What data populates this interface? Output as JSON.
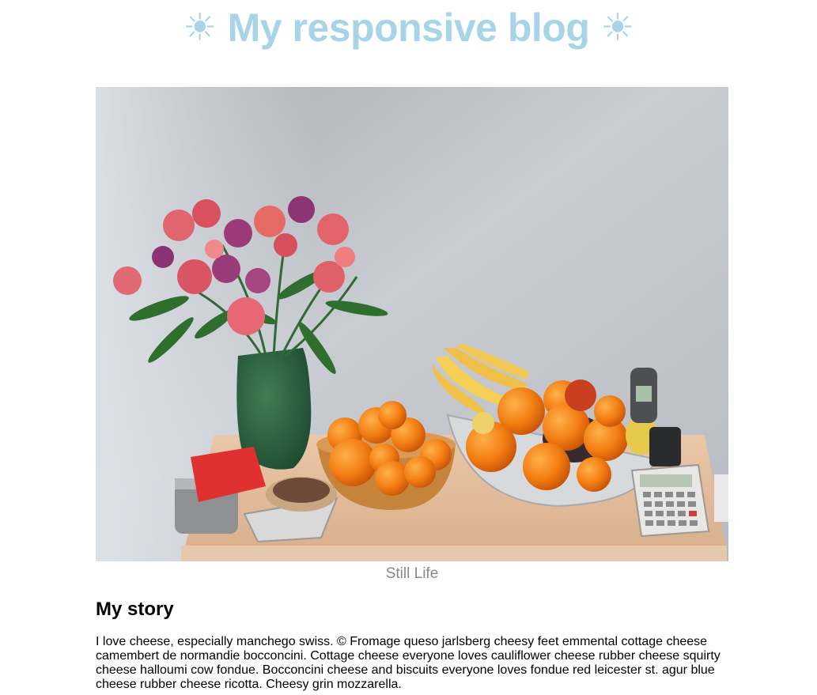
{
  "header": {
    "title": "My responsive blog",
    "icon_left": "☀",
    "icon_right": "☀",
    "icon_name": "sun-icon"
  },
  "colors": {
    "title": "#a8d4e8"
  },
  "figure": {
    "caption": "Still Life"
  },
  "story": {
    "heading": "My story",
    "body": "I love cheese, especially manchego swiss. © Fromage queso jarlsberg cheesy feet emmental cottage cheese camembert de normandie bocconcini. Cottage cheese everyone loves cauliflower cheese rubber cheese squirty cheese halloumi cow fondue. Bocconcini cheese and biscuits everyone loves fondue red leicester st. agur blue cheese rubber cheese ricotta. Cheesy grin mozzarella."
  }
}
